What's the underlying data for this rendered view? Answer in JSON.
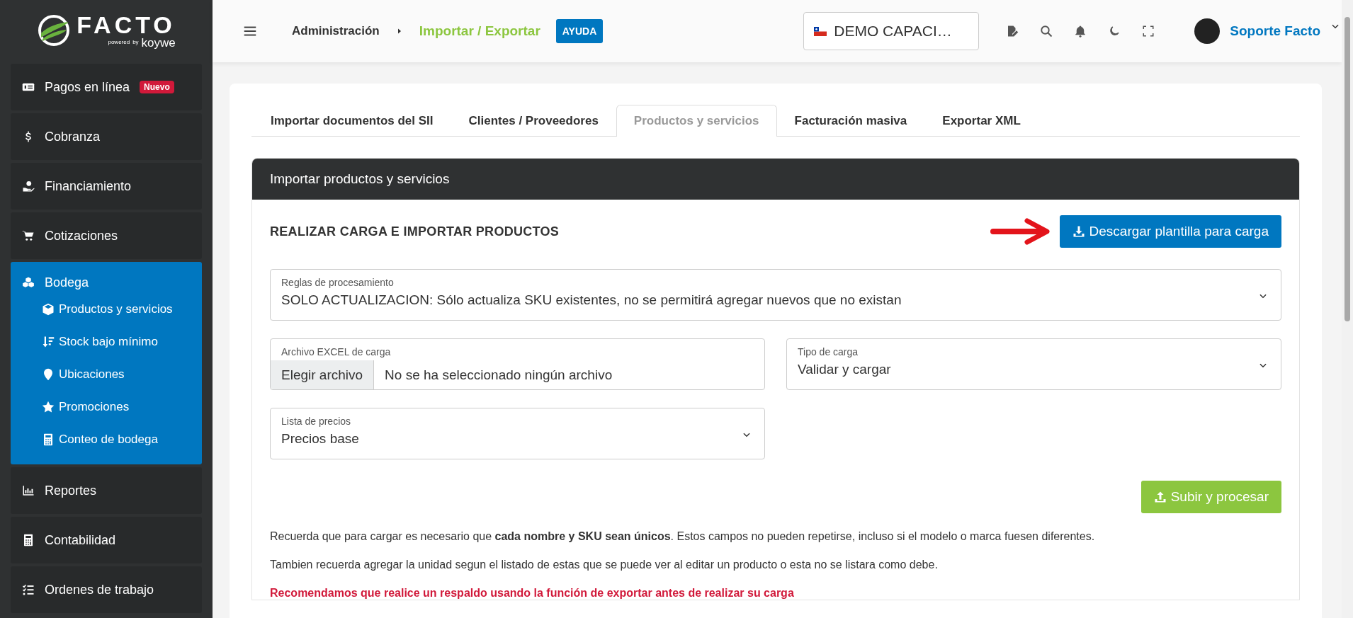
{
  "logo": {
    "name": "FACTO",
    "powered": "powered",
    "by": "by",
    "brand": "koywe"
  },
  "sidebar": {
    "items": [
      {
        "label": "Pagos en línea",
        "badge": "Nuevo",
        "selected": false,
        "expanded": false
      },
      {
        "label": "Cobranza",
        "selected": false,
        "expanded": false
      },
      {
        "label": "Financiamiento",
        "selected": false,
        "expanded": false
      },
      {
        "label": "Cotizaciones",
        "selected": false,
        "expanded": false
      },
      {
        "label": "Bodega",
        "selected": true,
        "expanded": true,
        "children": [
          {
            "label": "Productos y servicios"
          },
          {
            "label": "Stock bajo mínimo"
          },
          {
            "label": "Ubicaciones"
          },
          {
            "label": "Promociones"
          },
          {
            "label": "Conteo de bodega"
          }
        ]
      },
      {
        "label": "Reportes",
        "selected": false,
        "expanded": false
      },
      {
        "label": "Contabilidad",
        "selected": false,
        "expanded": false
      },
      {
        "label": "Ordenes de trabajo",
        "selected": false,
        "expanded": false
      }
    ]
  },
  "header": {
    "breadcrumb": [
      "Administración",
      "Importar / Exportar"
    ],
    "help": "AYUDA",
    "company": "DEMO CAPACI…",
    "user": "Soporte Facto"
  },
  "tabs": [
    {
      "label": "Importar documentos del SII",
      "selected": false
    },
    {
      "label": "Clientes / Proveedores",
      "selected": false
    },
    {
      "label": "Productos y servicios",
      "selected": true
    },
    {
      "label": "Facturación masiva",
      "selected": false
    },
    {
      "label": "Exportar XML",
      "selected": false
    }
  ],
  "card": {
    "title": "Importar productos y servicios",
    "heading": "REALIZAR CARGA E IMPORTAR PRODUCTOS",
    "download_button": "Descargar plantilla para carga",
    "fields": [
      {
        "kind": "select",
        "label": "Reglas de procesamiento",
        "value": "SOLO ACTUALIZACION: Sólo actualiza SKU existentes, no se permitirá agregar nuevos que no existan"
      },
      {
        "kind": "file",
        "label": "Archivo EXCEL de carga",
        "button": "Elegir archivo",
        "value": "No se ha seleccionado ningún archivo"
      },
      {
        "kind": "select",
        "label": "Tipo de carga",
        "value": "Validar y cargar"
      },
      {
        "kind": "select",
        "label": "Lista de precios",
        "value": "Precios base"
      }
    ],
    "upload_button": "Subir y procesar",
    "notes": [
      {
        "kind": "info",
        "text": "Recuerda que para cargar es necesario que **cada nombre y SKU sean únicos**. Estos campos no pueden repetirse, incluso si el modelo o marca fuesen diferentes."
      },
      {
        "kind": "info",
        "text": "Tambien recuerda agregar la unidad segun el listado de estas que se puede ver al editar un producto o esta no se listara como debe."
      },
      {
        "kind": "warning",
        "text": "Recomendamos que realice un respaldo usando la función de exportar antes de realizar su carga"
      }
    ]
  }
}
